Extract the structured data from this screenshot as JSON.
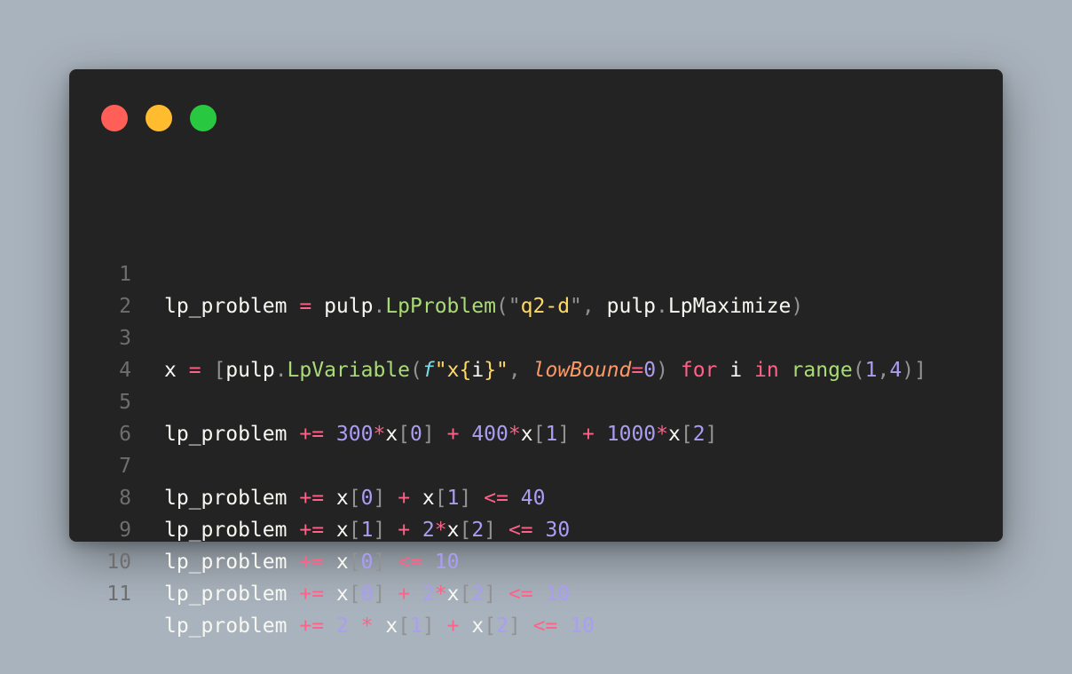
{
  "window": {
    "controls": [
      "close",
      "minimize",
      "zoom"
    ]
  },
  "colors": {
    "background": "#a9b3bd",
    "editor_background": "#232323",
    "line_number": "#6e6e6e",
    "plain": "#f8f8f2",
    "operator": "#ff6188",
    "number": "#ab9df2",
    "punctuation": "#939293",
    "function": "#a9dc76",
    "string": "#ffd866",
    "parameter": "#fc9867",
    "f_string_prefix": "#78dce8"
  },
  "code": {
    "lines": [
      {
        "number": "1",
        "tokens": [
          {
            "t": "lp_problem",
            "k": "plain"
          },
          {
            "t": " ",
            "k": "plain"
          },
          {
            "t": "=",
            "k": "op"
          },
          {
            "t": " ",
            "k": "plain"
          },
          {
            "t": "pulp",
            "k": "plain"
          },
          {
            "t": ".",
            "k": "punc"
          },
          {
            "t": "LpProblem",
            "k": "func"
          },
          {
            "t": "(",
            "k": "punc"
          },
          {
            "t": "\"",
            "k": "punc"
          },
          {
            "t": "q2-d",
            "k": "str"
          },
          {
            "t": "\"",
            "k": "punc"
          },
          {
            "t": ",",
            "k": "punc"
          },
          {
            "t": " ",
            "k": "plain"
          },
          {
            "t": "pulp",
            "k": "plain"
          },
          {
            "t": ".",
            "k": "punc"
          },
          {
            "t": "LpMaximize",
            "k": "plain"
          },
          {
            "t": ")",
            "k": "punc"
          }
        ]
      },
      {
        "number": "2",
        "tokens": []
      },
      {
        "number": "3",
        "tokens": [
          {
            "t": "x",
            "k": "plain"
          },
          {
            "t": " ",
            "k": "plain"
          },
          {
            "t": "=",
            "k": "op"
          },
          {
            "t": " ",
            "k": "plain"
          },
          {
            "t": "[",
            "k": "punc"
          },
          {
            "t": "pulp",
            "k": "plain"
          },
          {
            "t": ".",
            "k": "punc"
          },
          {
            "t": "LpVariable",
            "k": "func"
          },
          {
            "t": "(",
            "k": "punc"
          },
          {
            "t": "f",
            "k": "fprefix"
          },
          {
            "t": "\"",
            "k": "str"
          },
          {
            "t": "x",
            "k": "str"
          },
          {
            "t": "{",
            "k": "str"
          },
          {
            "t": "i",
            "k": "plain"
          },
          {
            "t": "}",
            "k": "str"
          },
          {
            "t": "\"",
            "k": "str"
          },
          {
            "t": ",",
            "k": "punc"
          },
          {
            "t": " ",
            "k": "plain"
          },
          {
            "t": "lowBound",
            "k": "param"
          },
          {
            "t": "=",
            "k": "op"
          },
          {
            "t": "0",
            "k": "num"
          },
          {
            "t": ")",
            "k": "punc"
          },
          {
            "t": " ",
            "k": "plain"
          },
          {
            "t": "for",
            "k": "op"
          },
          {
            "t": " ",
            "k": "plain"
          },
          {
            "t": "i",
            "k": "plain"
          },
          {
            "t": " ",
            "k": "plain"
          },
          {
            "t": "in",
            "k": "op"
          },
          {
            "t": " ",
            "k": "plain"
          },
          {
            "t": "range",
            "k": "func"
          },
          {
            "t": "(",
            "k": "punc"
          },
          {
            "t": "1",
            "k": "num"
          },
          {
            "t": ",",
            "k": "punc"
          },
          {
            "t": "4",
            "k": "num"
          },
          {
            "t": ")",
            "k": "punc"
          },
          {
            "t": "]",
            "k": "punc"
          }
        ]
      },
      {
        "number": "4",
        "tokens": []
      },
      {
        "number": "5",
        "tokens": [
          {
            "t": "lp_problem",
            "k": "plain"
          },
          {
            "t": " ",
            "k": "plain"
          },
          {
            "t": "+=",
            "k": "op"
          },
          {
            "t": " ",
            "k": "plain"
          },
          {
            "t": "300",
            "k": "num"
          },
          {
            "t": "*",
            "k": "op"
          },
          {
            "t": "x",
            "k": "plain"
          },
          {
            "t": "[",
            "k": "punc"
          },
          {
            "t": "0",
            "k": "num"
          },
          {
            "t": "]",
            "k": "punc"
          },
          {
            "t": " ",
            "k": "plain"
          },
          {
            "t": "+",
            "k": "op"
          },
          {
            "t": " ",
            "k": "plain"
          },
          {
            "t": "400",
            "k": "num"
          },
          {
            "t": "*",
            "k": "op"
          },
          {
            "t": "x",
            "k": "plain"
          },
          {
            "t": "[",
            "k": "punc"
          },
          {
            "t": "1",
            "k": "num"
          },
          {
            "t": "]",
            "k": "punc"
          },
          {
            "t": " ",
            "k": "plain"
          },
          {
            "t": "+",
            "k": "op"
          },
          {
            "t": " ",
            "k": "plain"
          },
          {
            "t": "1000",
            "k": "num"
          },
          {
            "t": "*",
            "k": "op"
          },
          {
            "t": "x",
            "k": "plain"
          },
          {
            "t": "[",
            "k": "punc"
          },
          {
            "t": "2",
            "k": "num"
          },
          {
            "t": "]",
            "k": "punc"
          }
        ]
      },
      {
        "number": "6",
        "tokens": []
      },
      {
        "number": "7",
        "tokens": [
          {
            "t": "lp_problem",
            "k": "plain"
          },
          {
            "t": " ",
            "k": "plain"
          },
          {
            "t": "+=",
            "k": "op"
          },
          {
            "t": " ",
            "k": "plain"
          },
          {
            "t": "x",
            "k": "plain"
          },
          {
            "t": "[",
            "k": "punc"
          },
          {
            "t": "0",
            "k": "num"
          },
          {
            "t": "]",
            "k": "punc"
          },
          {
            "t": " ",
            "k": "plain"
          },
          {
            "t": "+",
            "k": "op"
          },
          {
            "t": " ",
            "k": "plain"
          },
          {
            "t": "x",
            "k": "plain"
          },
          {
            "t": "[",
            "k": "punc"
          },
          {
            "t": "1",
            "k": "num"
          },
          {
            "t": "]",
            "k": "punc"
          },
          {
            "t": " ",
            "k": "plain"
          },
          {
            "t": "<=",
            "k": "op"
          },
          {
            "t": " ",
            "k": "plain"
          },
          {
            "t": "40",
            "k": "num"
          }
        ]
      },
      {
        "number": "8",
        "tokens": [
          {
            "t": "lp_problem",
            "k": "plain"
          },
          {
            "t": " ",
            "k": "plain"
          },
          {
            "t": "+=",
            "k": "op"
          },
          {
            "t": " ",
            "k": "plain"
          },
          {
            "t": "x",
            "k": "plain"
          },
          {
            "t": "[",
            "k": "punc"
          },
          {
            "t": "1",
            "k": "num"
          },
          {
            "t": "]",
            "k": "punc"
          },
          {
            "t": " ",
            "k": "plain"
          },
          {
            "t": "+",
            "k": "op"
          },
          {
            "t": " ",
            "k": "plain"
          },
          {
            "t": "2",
            "k": "num"
          },
          {
            "t": "*",
            "k": "op"
          },
          {
            "t": "x",
            "k": "plain"
          },
          {
            "t": "[",
            "k": "punc"
          },
          {
            "t": "2",
            "k": "num"
          },
          {
            "t": "]",
            "k": "punc"
          },
          {
            "t": " ",
            "k": "plain"
          },
          {
            "t": "<=",
            "k": "op"
          },
          {
            "t": " ",
            "k": "plain"
          },
          {
            "t": "30",
            "k": "num"
          }
        ]
      },
      {
        "number": "9",
        "tokens": [
          {
            "t": "lp_problem",
            "k": "plain"
          },
          {
            "t": " ",
            "k": "plain"
          },
          {
            "t": "+=",
            "k": "op"
          },
          {
            "t": " ",
            "k": "plain"
          },
          {
            "t": "x",
            "k": "plain"
          },
          {
            "t": "[",
            "k": "punc"
          },
          {
            "t": "0",
            "k": "num"
          },
          {
            "t": "]",
            "k": "punc"
          },
          {
            "t": " ",
            "k": "plain"
          },
          {
            "t": "<=",
            "k": "op"
          },
          {
            "t": " ",
            "k": "plain"
          },
          {
            "t": "10",
            "k": "num"
          }
        ]
      },
      {
        "number": "10",
        "tokens": [
          {
            "t": "lp_problem",
            "k": "plain"
          },
          {
            "t": " ",
            "k": "plain"
          },
          {
            "t": "+=",
            "k": "op"
          },
          {
            "t": " ",
            "k": "plain"
          },
          {
            "t": "x",
            "k": "plain"
          },
          {
            "t": "[",
            "k": "punc"
          },
          {
            "t": "0",
            "k": "num"
          },
          {
            "t": "]",
            "k": "punc"
          },
          {
            "t": " ",
            "k": "plain"
          },
          {
            "t": "+",
            "k": "op"
          },
          {
            "t": " ",
            "k": "plain"
          },
          {
            "t": "2",
            "k": "num"
          },
          {
            "t": "*",
            "k": "op"
          },
          {
            "t": "x",
            "k": "plain"
          },
          {
            "t": "[",
            "k": "punc"
          },
          {
            "t": "2",
            "k": "num"
          },
          {
            "t": "]",
            "k": "punc"
          },
          {
            "t": " ",
            "k": "plain"
          },
          {
            "t": "<=",
            "k": "op"
          },
          {
            "t": " ",
            "k": "plain"
          },
          {
            "t": "10",
            "k": "num"
          }
        ]
      },
      {
        "number": "11",
        "tokens": [
          {
            "t": "lp_problem",
            "k": "plain"
          },
          {
            "t": " ",
            "k": "plain"
          },
          {
            "t": "+=",
            "k": "op"
          },
          {
            "t": " ",
            "k": "plain"
          },
          {
            "t": "2",
            "k": "num"
          },
          {
            "t": " ",
            "k": "plain"
          },
          {
            "t": "*",
            "k": "op"
          },
          {
            "t": " ",
            "k": "plain"
          },
          {
            "t": "x",
            "k": "plain"
          },
          {
            "t": "[",
            "k": "punc"
          },
          {
            "t": "1",
            "k": "num"
          },
          {
            "t": "]",
            "k": "punc"
          },
          {
            "t": " ",
            "k": "plain"
          },
          {
            "t": "+",
            "k": "op"
          },
          {
            "t": " ",
            "k": "plain"
          },
          {
            "t": "x",
            "k": "plain"
          },
          {
            "t": "[",
            "k": "punc"
          },
          {
            "t": "2",
            "k": "num"
          },
          {
            "t": "]",
            "k": "punc"
          },
          {
            "t": " ",
            "k": "plain"
          },
          {
            "t": "<=",
            "k": "op"
          },
          {
            "t": " ",
            "k": "plain"
          },
          {
            "t": "10",
            "k": "num"
          }
        ]
      }
    ]
  }
}
